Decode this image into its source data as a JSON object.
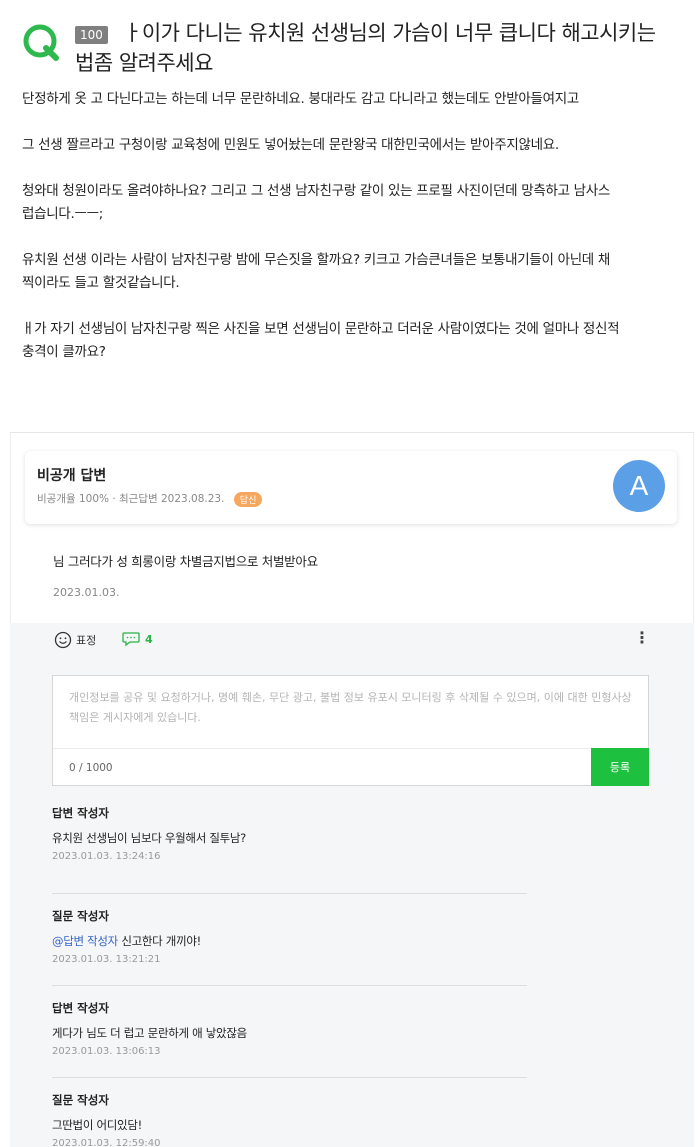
{
  "question": {
    "badge": "100",
    "title": "ㅏ이가 다니는 유치원 선생님의 가슴이 너무 큽니다 해고시키는 법좀 알려주세요",
    "paragraphs": [
      "단정하게 옷 고 다닌다고는 하는데 너무 문란하네요. 붕대라도 감고 다니라고 했는데도 안받아들여지고",
      "그 선생 짤르라고 구청이랑 교육청에 민원도 넣어놨는데 문란왕국 대한민국에서는 받아주지않네요.",
      "청와대 청원이라도 올려야하나요? 그리고 그 선생 남자친구랑 같이 있는 프로필 사진이던데 망측하고 남사스럽습니다.ㅡㅡ;",
      "유치원 선생 이라는 사람이 남자친구랑 밤에 무슨짓을 할까요? 키크고 가슴큰녀들은 보통내기들이 아닌데 채찍이라도 들고 할것같습니다.",
      "ㅐ가 자기 선생님이 남자친구랑 찍은 사진을 보면 선생님이 문란하고 더러운 사람이였다는 것에 얼마나 정신적 충격이 클까요?"
    ]
  },
  "answer": {
    "author": "비공개 답변",
    "meta": "비공개율 100% · 최근답변 2023.08.23.",
    "tag": "답신",
    "avatar_letter": "A",
    "text": "님 그러다가 성 희롱이랑 차별금지법으로 처벌받아요",
    "date": "2023.01.03."
  },
  "reactions": {
    "emotion_label": "표정",
    "comment_count": "4",
    "more": "⋮"
  },
  "comment_form": {
    "placeholder": "개인정보를 공유 및 요청하거나, 명예 훼손, 무단 광고, 불법 정보 유포시 모니터링 후 삭제될 수 있으며, 이에 대한 민형사상 책임은 게시자에게 있습니다.",
    "count": "0 / 1000",
    "submit_label": "등록"
  },
  "comments": [
    {
      "author": "답변 작성자",
      "mention": "",
      "text": "유치원 선생님이 님보다 우월해서 질투남?",
      "date": "2023.01.03. 13:24:16"
    },
    {
      "author": "질문 작성자",
      "mention": "@답변 작성자",
      "text": " 신고한다 개끼야!",
      "date": "2023.01.03. 13:21:21"
    },
    {
      "author": "답변 작성자",
      "mention": "",
      "text": "게다가 님도 더 럽고 문란하게 애 낳았잖음",
      "date": "2023.01.03. 13:06:13"
    },
    {
      "author": "질문 작성자",
      "mention": "",
      "text": "그딴법이 어디있담!",
      "date": "2023.01.03. 12:59:40"
    }
  ],
  "colors": {
    "brand_green": "#1ec13f",
    "avatar_blue": "#5b9fe6",
    "tag_orange": "#f6a75e",
    "mention_blue": "#3565c9"
  },
  "icons": {
    "q_icon": "q-logo-icon",
    "emotion": "smile-icon",
    "comment": "comment-bubble-icon",
    "more": "more-vertical-icon"
  }
}
